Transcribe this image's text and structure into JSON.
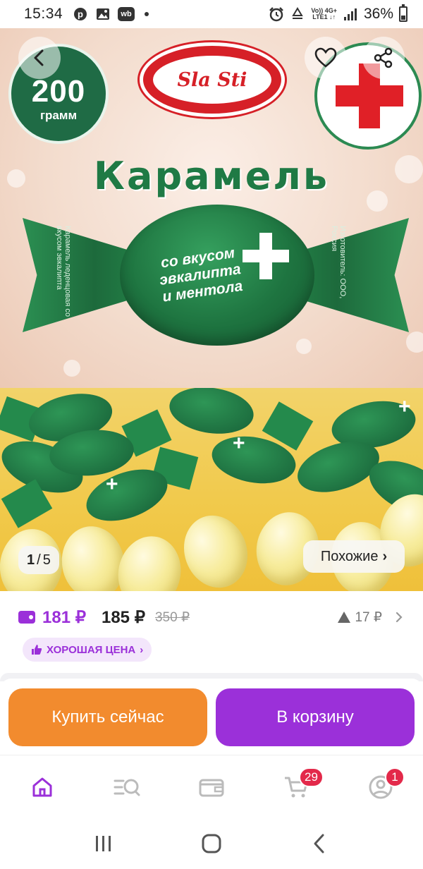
{
  "status_bar": {
    "time": "15:34",
    "left_icons": [
      "pinterest-icon",
      "gallery-icon",
      "wb-app-icon",
      "notification-dot"
    ],
    "wb_label": "wb",
    "network_top": "Vo)) 4G+",
    "network_bottom": "LTE1 ↓↑",
    "battery": "36%",
    "battery_level": 0.36
  },
  "product_image": {
    "weight_number": "200",
    "weight_unit": "грамм",
    "brand": "Sla Sti",
    "title": "Карамель",
    "candy_label_line1": "со вкусом",
    "candy_label_line2": "эвкалипта",
    "candy_label_line3": "и ментола",
    "side_text_left": "Карамель леденцовая со вкусом эвкалипта",
    "side_text_right": "Изготовитель: ООО, Россия"
  },
  "gallery": {
    "current": "1",
    "total": "5",
    "separator": "/",
    "similar_label": "Похожие",
    "similar_chevron": "›"
  },
  "price": {
    "wallet_price": "181 ₽",
    "price": "185 ₽",
    "old_price": "350 ₽",
    "change": "17 ₽",
    "good_price_label": "ХОРОШАЯ ЦЕНА",
    "chevron": "›"
  },
  "actions": {
    "buy_now": "Купить сейчас",
    "add_to_cart": "В корзину"
  },
  "tab_bar": {
    "cart_count": "29",
    "profile_count": "1"
  },
  "colors": {
    "accent": "#9b30d9",
    "buy_now": "#f28b2e",
    "badge": "#e3294a",
    "candy_green": "#1f7a45"
  }
}
